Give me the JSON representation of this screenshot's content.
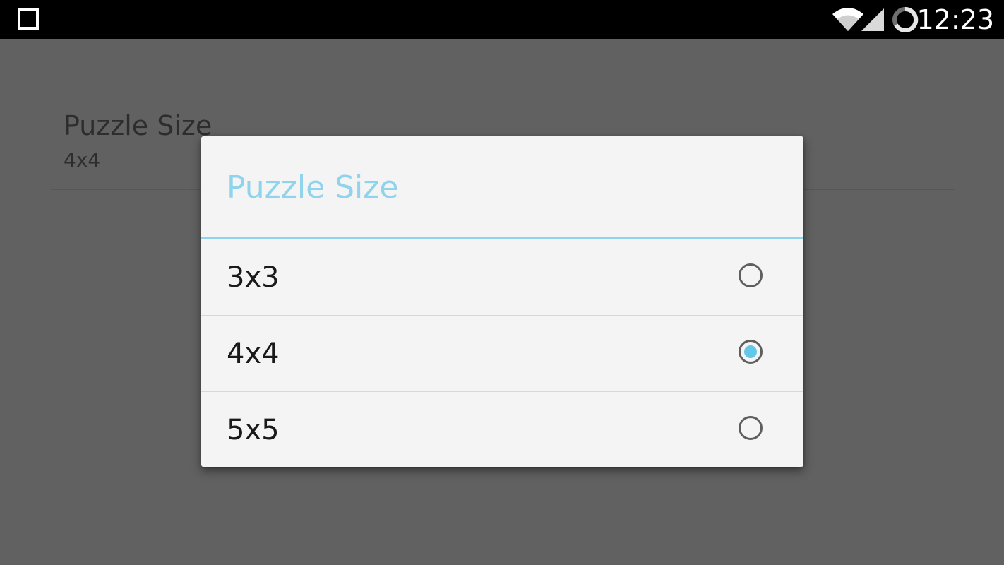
{
  "status_bar": {
    "time": "12:23",
    "icons": [
      "recents-icon",
      "wifi-icon",
      "cell-signal-icon",
      "battery-icon"
    ]
  },
  "preference": {
    "title": "Puzzle Size",
    "summary": "4x4"
  },
  "dialog": {
    "title": "Puzzle Size",
    "options": [
      {
        "label": "3x3",
        "selected": false
      },
      {
        "label": "4x4",
        "selected": true
      },
      {
        "label": "5x5",
        "selected": false
      }
    ]
  },
  "colors": {
    "accent": "#8fd3ec",
    "radio_selected": "#63c8e8",
    "scrim": "#616161",
    "dialog_bg": "#f4f4f4"
  }
}
